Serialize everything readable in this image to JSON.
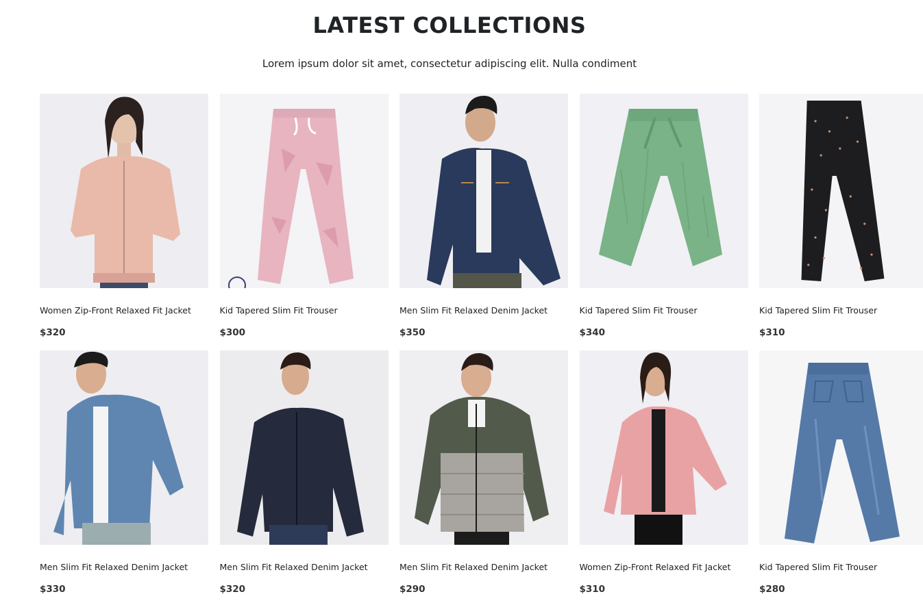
{
  "section": {
    "title": "LATEST COLLECTIONS",
    "subtitle": "Lorem ipsum dolor sit amet, consectetur adipiscing elit. Nulla condiment"
  },
  "products": [
    {
      "name": "Women Zip-Front Relaxed Fit Jacket",
      "price": "$320",
      "image": "woman-pink-bomber-jacket",
      "bg": "#eeedf1",
      "color": "#e9b9aa"
    },
    {
      "name": "Kid Tapered Slim Fit Trouser",
      "price": "$300",
      "image": "pink-camo-joggers",
      "bg": "#f4f3f5",
      "color": "#e7b4c0"
    },
    {
      "name": "Men Slim Fit Relaxed Denim Jacket",
      "price": "$350",
      "image": "man-dark-denim-jacket",
      "bg": "#efeef2",
      "color": "#2a3a5c"
    },
    {
      "name": "Kid Tapered Slim Fit Trouser",
      "price": "$340",
      "image": "green-culottes",
      "bg": "#f1f0f5",
      "color": "#79b387"
    },
    {
      "name": "Kid Tapered Slim Fit Trouser",
      "price": "$310",
      "image": "black-dotted-leggings",
      "bg": "#f4f3f5",
      "color": "#1d1d1f"
    },
    {
      "name": "Men Slim Fit Relaxed Denim Jacket",
      "price": "$330",
      "image": "man-light-denim-jacket",
      "bg": "#eeedf1",
      "color": "#5f86b0"
    },
    {
      "name": "Men Slim Fit Relaxed Denim Jacket",
      "price": "$320",
      "image": "man-navy-jacket",
      "bg": "#ececef",
      "color": "#252b3c"
    },
    {
      "name": "Men Slim Fit Relaxed Denim Jacket",
      "price": "$290",
      "image": "man-puffer-jacket",
      "bg": "#efeef1",
      "color": "#525a4b"
    },
    {
      "name": "Women Zip-Front Relaxed Fit Jacket",
      "price": "$310",
      "image": "woman-pink-jacket",
      "bg": "#f0eff3",
      "color": "#e8a2a4"
    },
    {
      "name": "Kid Tapered Slim Fit Trouser",
      "price": "$280",
      "image": "blue-denim-jeans",
      "bg": "#f6f6f7",
      "color": "#557aa8"
    }
  ]
}
